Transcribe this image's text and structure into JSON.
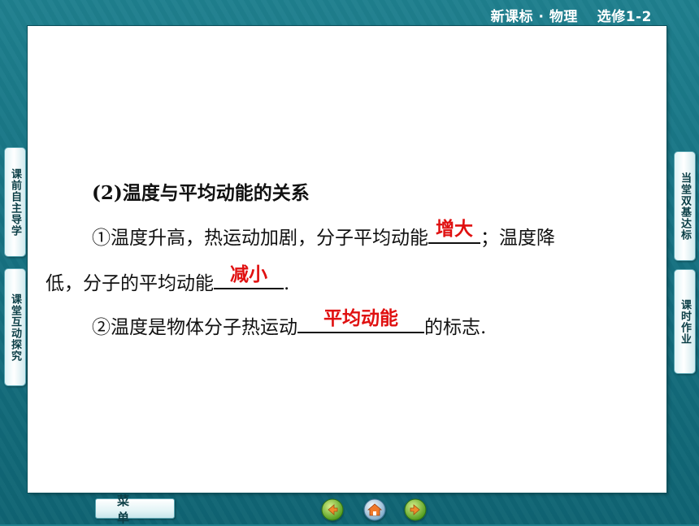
{
  "header": {
    "title": "新课标 · 物理　 选修1-2"
  },
  "content": {
    "heading": "(2)温度与平均动能的关系",
    "item1_prefix": "①温度升高，热运动加剧，分子平均动能",
    "item1_answer": "增大",
    "item1_suffix": "；温度降",
    "item1_cont_prefix": "低，分子的平均动能",
    "item1_cont_answer": "减小",
    "item1_cont_suffix": ".",
    "item2_prefix": "②温度是物体分子热运动",
    "item2_answer": "平均动能",
    "item2_suffix": "的标志."
  },
  "left_tabs": [
    {
      "label": "课前自主导学"
    },
    {
      "label": "课堂互动探究"
    }
  ],
  "right_tabs": [
    {
      "label": "当堂双基达标"
    },
    {
      "label": "课时作业"
    }
  ],
  "bottom": {
    "menu_label": "菜单",
    "nav": [
      "back-arrow-icon",
      "home-icon",
      "forward-arrow-icon"
    ]
  },
  "colors": {
    "answer": "#e01010",
    "background": "#167383"
  }
}
